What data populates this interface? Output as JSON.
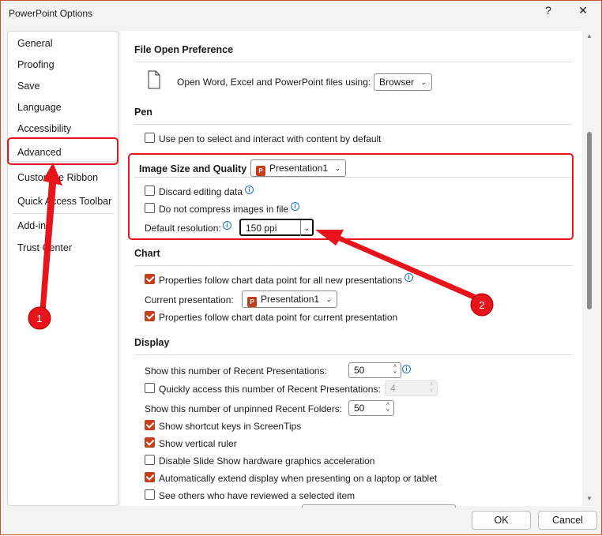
{
  "window": {
    "title": "PowerPoint Options",
    "help": "?",
    "close": "✕"
  },
  "sidebar": {
    "items": [
      {
        "label": "General"
      },
      {
        "label": "Proofing"
      },
      {
        "label": "Save"
      },
      {
        "label": "Language"
      },
      {
        "label": "Accessibility"
      },
      {
        "label": "Advanced",
        "selected": true
      },
      {
        "label": "Customize Ribbon"
      },
      {
        "label": "Quick Access Toolbar"
      },
      {
        "label": "Add-ins"
      },
      {
        "label": "Trust Center"
      }
    ]
  },
  "sections": {
    "file_open": {
      "heading": "File Open Preference",
      "label": "Open Word, Excel and PowerPoint files using:",
      "value": "Browser"
    },
    "pen": {
      "heading": "Pen",
      "use_pen": {
        "label": "Use pen to select and interact with content by default",
        "checked": false
      }
    },
    "image": {
      "heading": "Image Size and Quality",
      "presentation": "Presentation1",
      "discard": {
        "label": "Discard editing data",
        "checked": false
      },
      "no_compress": {
        "label": "Do not compress images in file",
        "checked": false
      },
      "resolution_label": "Default resolution:",
      "resolution": "150 ppi"
    },
    "chart": {
      "heading": "Chart",
      "follow_new": {
        "label": "Properties follow chart data point for all new presentations",
        "checked": true
      },
      "current_label": "Current presentation:",
      "current": "Presentation1",
      "follow_current": {
        "label": "Properties follow chart data point for current presentation",
        "checked": true
      }
    },
    "display": {
      "heading": "Display",
      "recent_label": "Show this number of Recent Presentations:",
      "recent": "50",
      "quick": {
        "label": "Quickly access this number of Recent Presentations:",
        "checked": false,
        "value": "4"
      },
      "folders_label": "Show this number of unpinned Recent Folders:",
      "folders": "50",
      "options": [
        {
          "label": "Show shortcut keys in ScreenTips",
          "checked": true
        },
        {
          "label": "Show vertical ruler",
          "checked": true
        },
        {
          "label": "Disable Slide Show hardware graphics acceleration",
          "checked": false
        },
        {
          "label": "Automatically extend display when presenting on a laptop or tablet",
          "checked": true
        },
        {
          "label": "See others who have reviewed a selected item",
          "checked": false
        }
      ]
    }
  },
  "buttons": {
    "ok": "OK",
    "cancel": "Cancel"
  },
  "annotations": {
    "one": "1",
    "two": "2",
    "color": "#e8141c"
  },
  "colors": {
    "accent": "#c43e1c",
    "info": "#1e73c8"
  }
}
